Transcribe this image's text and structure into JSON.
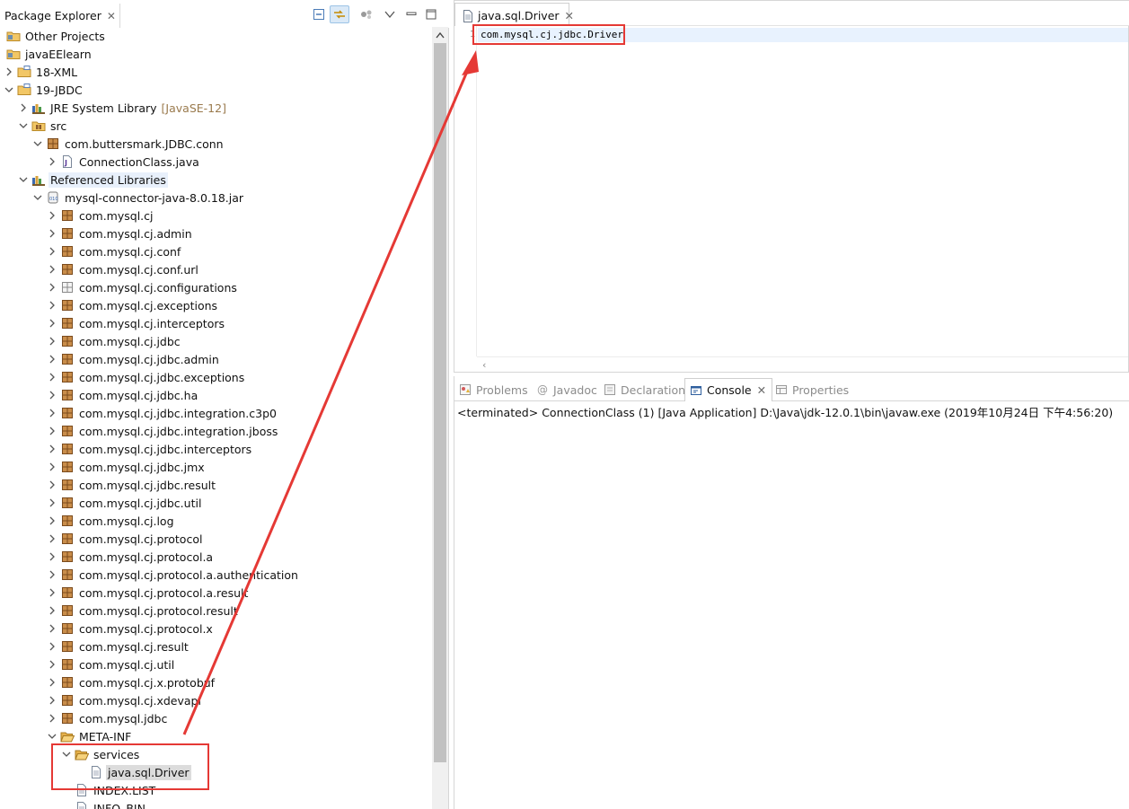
{
  "package_explorer": {
    "title": "Package Explorer",
    "tree": [
      {
        "label": "Other Projects",
        "level": 0,
        "arrow": "none",
        "icon": "working-set-folder-icon"
      },
      {
        "label": "javaEElearn",
        "level": 0,
        "arrow": "none",
        "icon": "working-set-folder-icon"
      },
      {
        "label": "18-XML",
        "level": 0,
        "arrow": "right",
        "icon": "project-folder-icon"
      },
      {
        "label": "19-JBDC",
        "level": 0,
        "arrow": "down",
        "icon": "project-folder-icon"
      },
      {
        "label": "JRE System Library",
        "decoration": "[JavaSE-12]",
        "level": 1,
        "arrow": "right",
        "icon": "library-icon"
      },
      {
        "label": "src",
        "level": 1,
        "arrow": "down",
        "icon": "source-folder-icon"
      },
      {
        "label": "com.buttersmark.JDBC.conn",
        "level": 2,
        "arrow": "down",
        "icon": "package-icon"
      },
      {
        "label": "ConnectionClass.java",
        "level": 3,
        "arrow": "right",
        "icon": "java-file-icon"
      },
      {
        "label": "Referenced Libraries",
        "level": 1,
        "arrow": "down",
        "icon": "library-icon",
        "highlight": "hover"
      },
      {
        "label": "mysql-connector-java-8.0.18.jar",
        "level": 2,
        "arrow": "down",
        "icon": "jar-icon"
      },
      {
        "label": "com.mysql.cj",
        "level": 3,
        "arrow": "right",
        "icon": "package-icon"
      },
      {
        "label": "com.mysql.cj.admin",
        "level": 3,
        "arrow": "right",
        "icon": "package-icon"
      },
      {
        "label": "com.mysql.cj.conf",
        "level": 3,
        "arrow": "right",
        "icon": "package-icon"
      },
      {
        "label": "com.mysql.cj.conf.url",
        "level": 3,
        "arrow": "right",
        "icon": "package-icon"
      },
      {
        "label": "com.mysql.cj.configurations",
        "level": 3,
        "arrow": "right",
        "icon": "empty-package-icon"
      },
      {
        "label": "com.mysql.cj.exceptions",
        "level": 3,
        "arrow": "right",
        "icon": "package-icon"
      },
      {
        "label": "com.mysql.cj.interceptors",
        "level": 3,
        "arrow": "right",
        "icon": "package-icon"
      },
      {
        "label": "com.mysql.cj.jdbc",
        "level": 3,
        "arrow": "right",
        "icon": "package-icon"
      },
      {
        "label": "com.mysql.cj.jdbc.admin",
        "level": 3,
        "arrow": "right",
        "icon": "package-icon"
      },
      {
        "label": "com.mysql.cj.jdbc.exceptions",
        "level": 3,
        "arrow": "right",
        "icon": "package-icon"
      },
      {
        "label": "com.mysql.cj.jdbc.ha",
        "level": 3,
        "arrow": "right",
        "icon": "package-icon"
      },
      {
        "label": "com.mysql.cj.jdbc.integration.c3p0",
        "level": 3,
        "arrow": "right",
        "icon": "package-icon"
      },
      {
        "label": "com.mysql.cj.jdbc.integration.jboss",
        "level": 3,
        "arrow": "right",
        "icon": "package-icon"
      },
      {
        "label": "com.mysql.cj.jdbc.interceptors",
        "level": 3,
        "arrow": "right",
        "icon": "package-icon"
      },
      {
        "label": "com.mysql.cj.jdbc.jmx",
        "level": 3,
        "arrow": "right",
        "icon": "package-icon"
      },
      {
        "label": "com.mysql.cj.jdbc.result",
        "level": 3,
        "arrow": "right",
        "icon": "package-icon"
      },
      {
        "label": "com.mysql.cj.jdbc.util",
        "level": 3,
        "arrow": "right",
        "icon": "package-icon"
      },
      {
        "label": "com.mysql.cj.log",
        "level": 3,
        "arrow": "right",
        "icon": "package-icon"
      },
      {
        "label": "com.mysql.cj.protocol",
        "level": 3,
        "arrow": "right",
        "icon": "package-icon"
      },
      {
        "label": "com.mysql.cj.protocol.a",
        "level": 3,
        "arrow": "right",
        "icon": "package-icon"
      },
      {
        "label": "com.mysql.cj.protocol.a.authentication",
        "level": 3,
        "arrow": "right",
        "icon": "package-icon"
      },
      {
        "label": "com.mysql.cj.protocol.a.result",
        "level": 3,
        "arrow": "right",
        "icon": "package-icon"
      },
      {
        "label": "com.mysql.cj.protocol.result",
        "level": 3,
        "arrow": "right",
        "icon": "package-icon"
      },
      {
        "label": "com.mysql.cj.protocol.x",
        "level": 3,
        "arrow": "right",
        "icon": "package-icon"
      },
      {
        "label": "com.mysql.cj.result",
        "level": 3,
        "arrow": "right",
        "icon": "package-icon"
      },
      {
        "label": "com.mysql.cj.util",
        "level": 3,
        "arrow": "right",
        "icon": "package-icon"
      },
      {
        "label": "com.mysql.cj.x.protobuf",
        "level": 3,
        "arrow": "right",
        "icon": "package-icon"
      },
      {
        "label": "com.mysql.cj.xdevapi",
        "level": 3,
        "arrow": "right",
        "icon": "package-icon"
      },
      {
        "label": "com.mysql.jdbc",
        "level": 3,
        "arrow": "right",
        "icon": "package-icon"
      },
      {
        "label": "META-INF",
        "level": 3,
        "arrow": "down",
        "icon": "open-folder-icon"
      },
      {
        "label": "services",
        "level": 4,
        "arrow": "down",
        "icon": "open-folder-icon"
      },
      {
        "label": "java.sql.Driver",
        "level": 5,
        "arrow": "none",
        "icon": "text-file-icon",
        "highlight": "selected"
      },
      {
        "label": "INDEX.LIST",
        "level": 4,
        "arrow": "none",
        "icon": "text-file-icon"
      },
      {
        "label": "INFO_BIN",
        "level": 4,
        "arrow": "none",
        "icon": "text-file-icon"
      }
    ]
  },
  "editor": {
    "tab_label": "java.sql.Driver",
    "line_number": "1",
    "code_line": "com.mysql.cj.jdbc.Driver"
  },
  "views": {
    "tabs": [
      {
        "label": "Problems",
        "icon": "problems-icon",
        "active": false
      },
      {
        "label": "Javadoc",
        "icon": "javadoc-icon",
        "active": false
      },
      {
        "label": "Declaration",
        "icon": "declaration-icon",
        "active": false
      },
      {
        "label": "Console",
        "icon": "console-icon",
        "active": true
      },
      {
        "label": "Properties",
        "icon": "properties-icon",
        "active": false
      }
    ],
    "console_text": "<terminated> ConnectionClass (1) [Java Application] D:\\Java\\jdk-12.0.1\\bin\\javaw.exe (2019年10月24日 下午4:56:20)"
  },
  "colors": {
    "annotation_red": "#e53935",
    "package_brown": "#8b5a2b",
    "folder_yellow": "#e8b44a",
    "selection_gray": "#dcdcdc",
    "editor_line_highlight": "#e8f2fe"
  }
}
